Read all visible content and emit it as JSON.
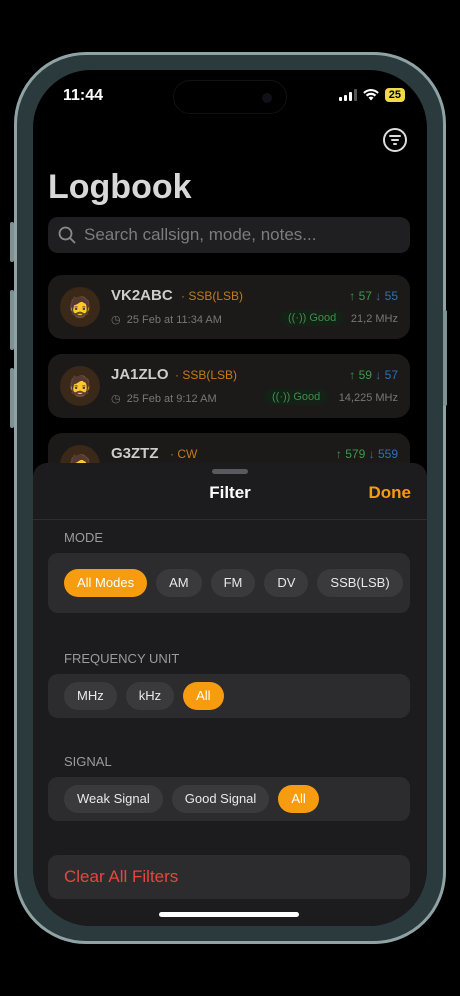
{
  "status": {
    "time": "11:44",
    "battery": "25"
  },
  "header": {
    "title": "Logbook"
  },
  "search": {
    "placeholder": "Search callsign, mode, notes..."
  },
  "contacts": [
    {
      "call": "VK2ABC",
      "mode": "SSB(LSB)",
      "time": "25 Feb at 11:34 AM",
      "sent": "57",
      "rcvd": "55",
      "signal": "Good",
      "freq": "21,2 MHz"
    },
    {
      "call": "JA1ZLO",
      "mode": "SSB(LSB)",
      "time": "25 Feb at 9:12 AM",
      "sent": "59",
      "rcvd": "57",
      "signal": "Good",
      "freq": "14,225 MHz"
    },
    {
      "call": "G3ZTZ",
      "mode": "CW",
      "sent": "579",
      "rcvd": "559"
    }
  ],
  "sheet": {
    "title": "Filter",
    "done": "Done",
    "mode_label": "MODE",
    "modes": [
      "All Modes",
      "AM",
      "FM",
      "DV",
      "SSB(LSB)"
    ],
    "freq_label": "FREQUENCY UNIT",
    "freq_units": [
      "MHz",
      "kHz",
      "All"
    ],
    "signal_label": "SIGNAL",
    "signals": [
      "Weak Signal",
      "Good Signal",
      "All"
    ],
    "clear": "Clear All Filters"
  },
  "colors": {
    "accent": "#f79b0f",
    "danger": "#e5473d",
    "good": "#3e8f49",
    "mode": "#c47a1c"
  }
}
